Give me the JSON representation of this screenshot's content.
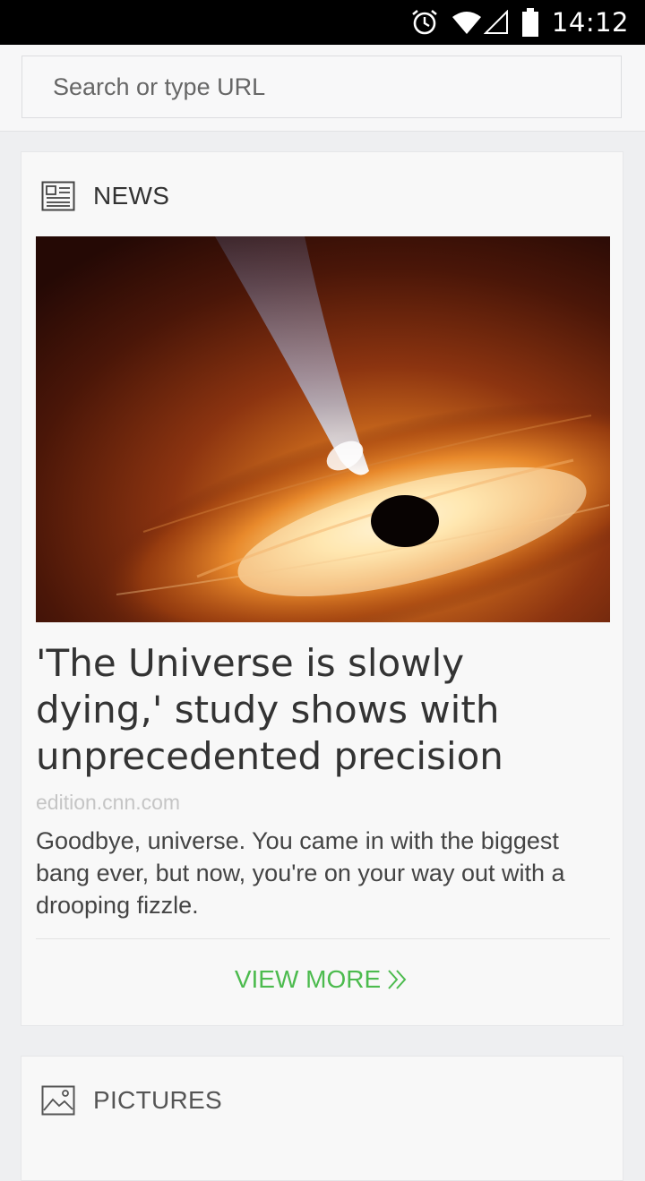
{
  "status_bar": {
    "time": "14:12",
    "icons": [
      "alarm-icon",
      "wifi-icon",
      "signal-icon",
      "battery-icon"
    ]
  },
  "search": {
    "placeholder": "Search or type URL",
    "value": ""
  },
  "news_card": {
    "section_title": "NEWS",
    "section_icon": "newspaper-icon",
    "image_icon": "black-hole-image",
    "headline": "'The Universe is slowly dying,' study shows with unprecedented precision",
    "source": "edition.cnn.com",
    "summary": "Goodbye, universe. You came in with the biggest bang ever, but now, you're on your way out with a drooping fizzle.",
    "view_more_label": "VIEW MORE",
    "view_more_icon": "double-chevron-right-icon"
  },
  "pictures_card": {
    "section_title": "PICTURES",
    "section_icon": "picture-icon"
  },
  "colors": {
    "accent": "#4cbb4e",
    "background": "#eeeff1",
    "card": "#f8f8f8",
    "status_bar": "#000000"
  }
}
